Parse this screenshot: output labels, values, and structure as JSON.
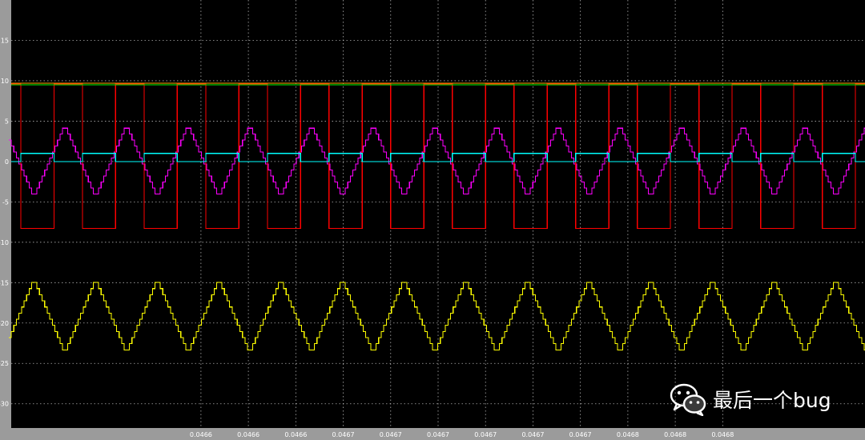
{
  "chart_data": {
    "type": "line",
    "title": "",
    "xlabel": "",
    "ylabel": "",
    "ylim": [
      -33,
      20
    ],
    "xlim": [
      0.04652,
      0.04688
    ],
    "grid": true,
    "legend": "none",
    "y_ticks": [
      -30,
      -25,
      -20,
      -15,
      -10,
      -5,
      0,
      5,
      10,
      15
    ],
    "x_ticks": [
      {
        "x": 0.0466,
        "label": "0.0466"
      },
      {
        "x": 0.04662,
        "label": "0.0466"
      },
      {
        "x": 0.04664,
        "label": "0.0466"
      },
      {
        "x": 0.04666,
        "label": "0.0467"
      },
      {
        "x": 0.04668,
        "label": "0.0467"
      },
      {
        "x": 0.0467,
        "label": "0.0467"
      },
      {
        "x": 0.04672,
        "label": "0.0467"
      },
      {
        "x": 0.04674,
        "label": "0.0467"
      },
      {
        "x": 0.04676,
        "label": "0.0467"
      },
      {
        "x": 0.04678,
        "label": "0.0468"
      },
      {
        "x": 0.0468,
        "label": "0.0468"
      },
      {
        "x": 0.04682,
        "label": "0.0468"
      }
    ],
    "series": [
      {
        "color": "#ffff00",
        "kind": "stepped-triangle",
        "period": 2.6e-05,
        "phase": 2e-06,
        "min": -23.7,
        "max": -14.6,
        "steps": 12
      },
      {
        "color": "#ff00ff",
        "kind": "stepped-triangle",
        "period": 2.6e-05,
        "phase": 1.5e-05,
        "min": -4.4,
        "max": 4.5,
        "steps": 12
      },
      {
        "color": "#ff0000",
        "kind": "square",
        "period": 2.6e-05,
        "high": 9.6,
        "low": -8.3,
        "low_start": 0.04655,
        "low_duration": 1.4e-05
      },
      {
        "color": "#00ffff",
        "kind": "pulse",
        "period": 2.6e-05,
        "high": 1.0,
        "low": 0.0,
        "high_start": 0.04655,
        "high_duration": 1.4e-05
      },
      {
        "color": "#00ff00",
        "kind": "constant",
        "value": 9.5
      },
      {
        "color": "#ffa500",
        "kind": "constant",
        "value": 9.7
      }
    ]
  },
  "watermark": {
    "text": "最后一个bug",
    "icon": "wechat-icon"
  },
  "colors": {
    "plot_background": "#000000",
    "frame": "#9b9b9b",
    "grid": "#d0d0d0",
    "tick_text": "#ffffff"
  }
}
